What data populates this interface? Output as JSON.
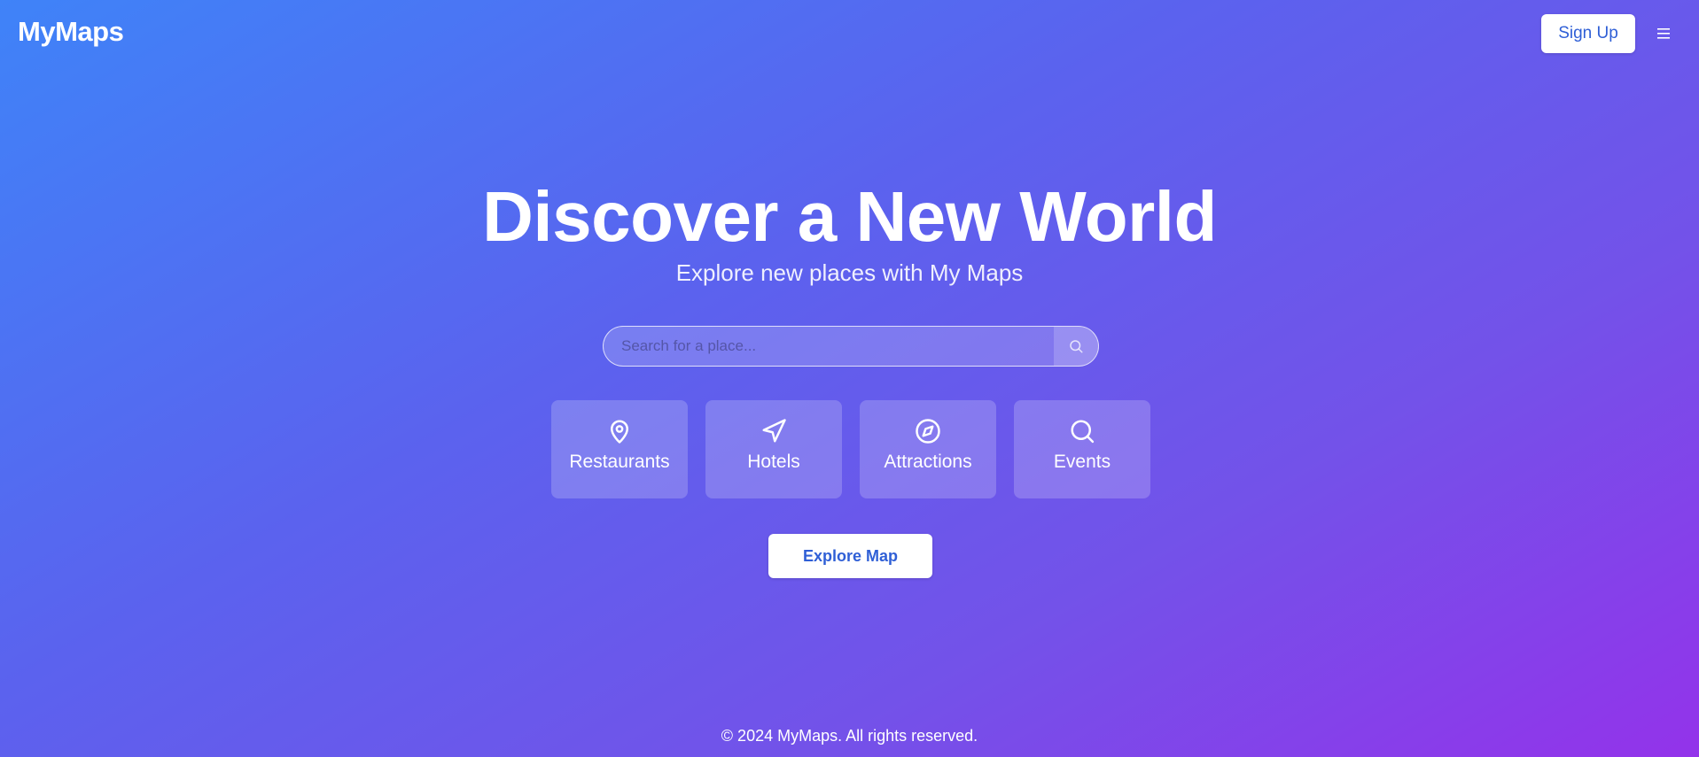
{
  "header": {
    "logo": "MyMaps",
    "signup_label": "Sign Up",
    "menu_icon": "hamburger-menu-icon"
  },
  "hero": {
    "title": "Discover a New World",
    "subtitle": "Explore new places with My Maps"
  },
  "search": {
    "placeholder": "Search for a place...",
    "value": "",
    "icon": "search-icon"
  },
  "categories": [
    {
      "label": "Restaurants",
      "icon": "map-pin-icon"
    },
    {
      "label": "Hotels",
      "icon": "navigation-arrow-icon"
    },
    {
      "label": "Attractions",
      "icon": "compass-icon"
    },
    {
      "label": "Events",
      "icon": "search-icon"
    }
  ],
  "cta": {
    "explore_label": "Explore Map"
  },
  "footer": {
    "copyright": "© 2024 MyMaps. All rights reserved."
  },
  "colors": {
    "gradient_start": "#3f83f8",
    "gradient_end": "#9333ea",
    "button_text": "#2f5fd6",
    "button_bg": "#ffffff"
  }
}
